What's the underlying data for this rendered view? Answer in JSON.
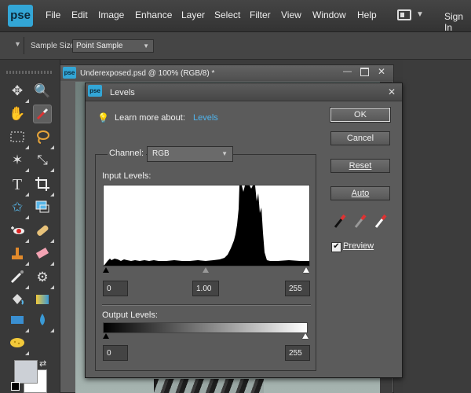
{
  "app": {
    "logo_text": "pse"
  },
  "menu": [
    "File",
    "Edit",
    "Image",
    "Enhance",
    "Layer",
    "Select",
    "Filter",
    "View",
    "Window",
    "Help"
  ],
  "signin": "Sign In",
  "options_bar": {
    "sample_size_label": "Sample Size:",
    "sample_size_value": "Point Sample"
  },
  "document": {
    "icon_text": "pse",
    "title": "Underexposed.psd @ 100% (RGB/8) *"
  },
  "dialog": {
    "icon_text": "pse",
    "title": "Levels",
    "learn_more_text": "Learn more about:",
    "learn_more_link": "Levels",
    "channel_label": "Channel:",
    "channel_value": "RGB",
    "input_levels_label": "Input Levels:",
    "input_black": "0",
    "input_gray": "1.00",
    "input_white": "255",
    "output_levels_label": "Output Levels:",
    "output_black": "0",
    "output_white": "255",
    "buttons": {
      "ok": "OK",
      "cancel": "Cancel",
      "reset": "Reset",
      "auto": "Auto"
    },
    "preview_label": "Preview",
    "preview_checked": true,
    "eyedroppers": [
      "black-point-eyedropper-icon",
      "gray-point-eyedropper-icon",
      "white-point-eyedropper-icon"
    ]
  },
  "tools": [
    "move-tool-icon",
    "zoom-tool-icon",
    "hand-tool-icon",
    "eyedropper-tool-icon",
    "marquee-tool-icon",
    "lasso-tool-icon",
    "magic-wand-tool-icon",
    "quick-selection-tool-icon",
    "type-tool-icon",
    "crop-tool-icon",
    "cookie-cutter-tool-icon",
    "recompose-tool-icon",
    "red-eye-tool-icon",
    "spot-healing-tool-icon",
    "clone-stamp-tool-icon",
    "eraser-tool-icon",
    "brush-tool-icon",
    "smart-brush-tool-icon",
    "paint-bucket-tool-icon",
    "gradient-tool-icon",
    "shape-tool-icon",
    "blur-tool-icon",
    "sponge-tool-icon"
  ],
  "colors": {
    "accent": "#33a6d6",
    "link": "#4fb4ee",
    "foreground_swatch": "#ccd0d6",
    "background_swatch": "#ffffff"
  }
}
